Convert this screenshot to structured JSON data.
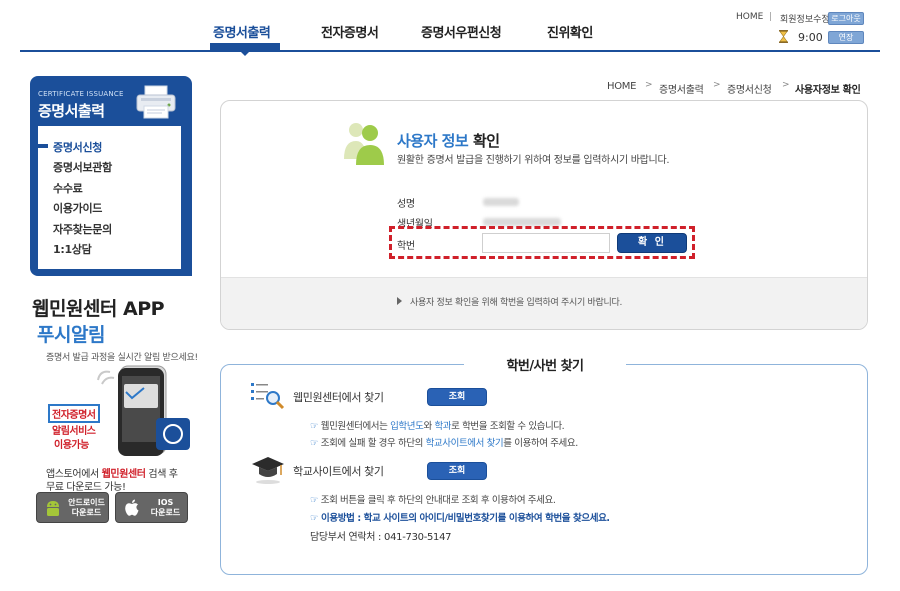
{
  "nav": {
    "items": [
      "증명서출력",
      "전자증명서",
      "증명서우편신청",
      "진위확인"
    ],
    "active_index": 0
  },
  "util": {
    "home": "HOME",
    "separator": "|",
    "edit_info": "회원정보수정",
    "logout": "로그아웃",
    "timer": "9:00",
    "extend": "연장"
  },
  "sidebar": {
    "title_en": "CERTIFICATE ISSUANCE",
    "title": "증명서출력",
    "items": [
      "증명서신청",
      "증명서보관함",
      "수수료",
      "이용가이드",
      "자주찾는문의",
      "1:1상담"
    ],
    "active_index": 0
  },
  "promo": {
    "title": "웹민원센터 APP",
    "subtitle": "푸시알림",
    "desc": "증명서 발급 과정을 실시간 알림 받으세요!",
    "label1": "전자증명서",
    "label2": "알림서비스",
    "label3": "이용가능",
    "store_line1_pre": "앱스토어에서 ",
    "store_line1_hl": "웹민원센터",
    "store_line1_post": " 검색 후",
    "store_line2": "무료 다운로드 가능!",
    "android_line1": "안드로이드",
    "android_line2": "다운로드",
    "ios_line1": "IOS",
    "ios_line2": "다운로드"
  },
  "breadcrumb": [
    "HOME",
    "증명서출력",
    "증명서신청",
    "사용자정보 확인"
  ],
  "verify": {
    "title_blue": "사용자 정보",
    "title_dark": "확인",
    "desc": "원활한 증명서 발급을 진행하기 위하여 정보를 입력하시기 바랍니다.",
    "name_label": "성명",
    "birth_label": "생년월일",
    "id_label": "학번",
    "id_value": "",
    "id_placeholder": "",
    "confirm": "확 인",
    "guide": "사용자 정보 확인을 위해 학번을 입력하여 주시기 바랍니다."
  },
  "find": {
    "title": "학번/사번 찾기",
    "sec1_title": "웹민원센터에서 찾기",
    "sec1_button": "조회",
    "sec1_line1_a": "웹민원센터에서는 ",
    "sec1_line1_b": "입학년도",
    "sec1_line1_c": "와 ",
    "sec1_line1_d": "학과",
    "sec1_line1_e": "로 학번을 조회할 수 있습니다.",
    "sec1_line2_a": "조회에 실패 할 경우 하단의 ",
    "sec1_line2_b": "학교사이트에서 찾기",
    "sec1_line2_c": "를 이용하여 주세요.",
    "sec2_title": "학교사이트에서 찾기",
    "sec2_button": "조회",
    "sec2_line1": "조회 버튼을 클릭 후 하단의 안내대로 조회 후 이용하여 주세요.",
    "sec2_line2": "이용방법 : 학교 사이트의 아이디/비밀번호찾기를 이용하여 학번을 찾으세요.",
    "contact": "담당부서 연락처 : 041-730-5147",
    "marker": "☞"
  },
  "colors": {
    "brand": "#1b4f9a",
    "accent": "#2d78c8",
    "highlight_red": "#d0202a"
  }
}
